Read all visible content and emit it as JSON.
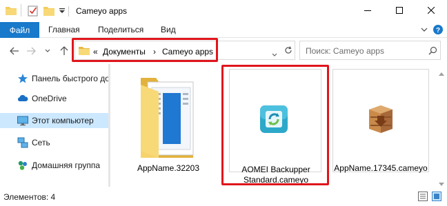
{
  "window": {
    "title": "Cameyo apps",
    "controls": [
      "minimize-icon",
      "maximize-icon",
      "close-icon"
    ]
  },
  "quick_access": {
    "icons": [
      "folder-icon",
      "properties-icon",
      "new-folder-icon",
      "customize-dropdown-icon"
    ]
  },
  "ribbon": {
    "tabs": [
      {
        "label": "Файл",
        "active": true
      },
      {
        "label": "Главная"
      },
      {
        "label": "Поделиться"
      },
      {
        "label": "Вид"
      }
    ],
    "accent_color": "#1979ca"
  },
  "address": {
    "overflow": "«",
    "crumbs": [
      "Документы",
      "Cameyo apps"
    ],
    "separator": "›"
  },
  "search": {
    "placeholder": "Поиск: Cameyo apps"
  },
  "nav": {
    "items": [
      {
        "label": "Панель быстрого до",
        "icon": "star-icon"
      },
      {
        "label": "OneDrive",
        "icon": "cloud-icon"
      },
      {
        "label": "Этот компьютер",
        "icon": "computer-icon",
        "selected": true
      },
      {
        "label": "Сеть",
        "icon": "network-icon"
      },
      {
        "label": "Домашняя группа",
        "icon": "homegroup-icon"
      }
    ]
  },
  "files": [
    {
      "name": "AppName.32203",
      "icon": "folder-icon"
    },
    {
      "name_line1": "AOMEI Backupper",
      "name_line2": "Standard.cameyo",
      "icon": "aomei-backupper-icon",
      "highlighted": true
    },
    {
      "name": "AppName.17345.cameyo",
      "icon": "package-box-icon"
    }
  ],
  "status": {
    "text": "Элементов: 4"
  },
  "highlight_color": "#e0151b"
}
